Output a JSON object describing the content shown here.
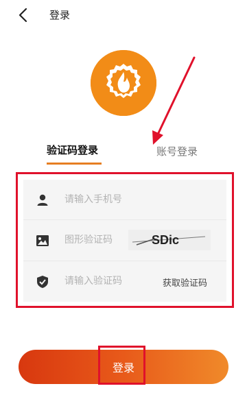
{
  "header": {
    "title": "登录",
    "back_icon": "chevron-left-icon"
  },
  "logo": {
    "icon": "flame-badge-icon",
    "color": "#f28c17"
  },
  "tabs": [
    {
      "label": "验证码登录",
      "active": true
    },
    {
      "label": "账号登录",
      "active": false
    }
  ],
  "form": {
    "phone": {
      "icon": "user-icon",
      "placeholder": "请输入手机号",
      "value": ""
    },
    "captcha": {
      "icon": "image-icon",
      "placeholder": "图形验证码",
      "value": "",
      "image_text": "SDic"
    },
    "code": {
      "icon": "shield-check-icon",
      "placeholder": "请输入验证码",
      "value": "",
      "get_code_label": "获取验证码"
    }
  },
  "login_button": {
    "label": "登录"
  },
  "colors": {
    "accent": "#e67e22",
    "highlight_outline": "#e0112b"
  }
}
